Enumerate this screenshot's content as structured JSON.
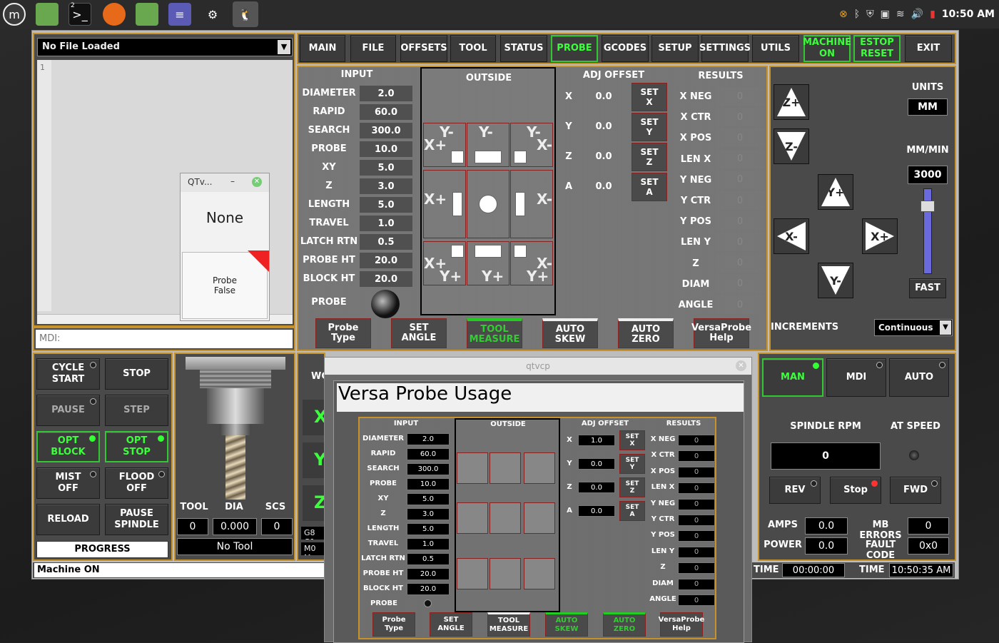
{
  "taskbar": {
    "clock": "10:50 AM",
    "term_badge": "2"
  },
  "file_combo": {
    "value": "No File Loaded"
  },
  "editor": {
    "line_no": "1"
  },
  "mdi": {
    "label": "MDI:"
  },
  "qt_popup": {
    "title": "QTv...",
    "minimize": "–",
    "value": "None",
    "probe_state": "Probe\nFalse"
  },
  "tabs": [
    "MAIN",
    "FILE",
    "OFFSETS",
    "TOOL",
    "STATUS",
    "PROBE",
    "GCODES",
    "SETUP",
    "SETTINGS",
    "UTILS"
  ],
  "machine_on": "MACHINE\nON",
  "estop": "ESTOP\nRESET",
  "exit": "EXIT",
  "probe_panel": {
    "input_title": "INPUT",
    "inputs": [
      {
        "label": "DIAMETER",
        "value": "2.0"
      },
      {
        "label": "RAPID",
        "value": "60.0"
      },
      {
        "label": "SEARCH",
        "value": "300.0"
      },
      {
        "label": "PROBE",
        "value": "10.0"
      },
      {
        "label": "XY",
        "value": "5.0"
      },
      {
        "label": "Z",
        "value": "3.0"
      },
      {
        "label": "LENGTH",
        "value": "5.0"
      },
      {
        "label": "TRAVEL",
        "value": "1.0"
      },
      {
        "label": "LATCH RTN",
        "value": "0.5"
      },
      {
        "label": "PROBE HT",
        "value": "20.0"
      },
      {
        "label": "BLOCK HT",
        "value": "20.0"
      }
    ],
    "probe_label": "PROBE",
    "outside_title": "OUTSIDE",
    "adj_title": "ADJ OFFSET",
    "adj": [
      {
        "axis": "X",
        "value": "0.0",
        "btn": "SET\nX"
      },
      {
        "axis": "Y",
        "value": "0.0",
        "btn": "SET\nY"
      },
      {
        "axis": "Z",
        "value": "0.0",
        "btn": "SET\nZ"
      },
      {
        "axis": "A",
        "value": "0.0",
        "btn": "SET\nA"
      }
    ],
    "results_title": "RESULTS",
    "results": [
      {
        "label": "X NEG",
        "value": "0"
      },
      {
        "label": "X CTR",
        "value": "0"
      },
      {
        "label": "X POS",
        "value": "0"
      },
      {
        "label": "LEN X",
        "value": "0"
      },
      {
        "label": "Y NEG",
        "value": "0"
      },
      {
        "label": "Y CTR",
        "value": "0"
      },
      {
        "label": "Y POS",
        "value": "0"
      },
      {
        "label": "LEN Y",
        "value": "0"
      },
      {
        "label": "Z",
        "value": "0"
      },
      {
        "label": "DIAM",
        "value": "0"
      },
      {
        "label": "ANGLE",
        "value": "0"
      }
    ],
    "bottom_buttons": [
      "Probe Type",
      "SET\nANGLE",
      "TOOL\nMEASURE",
      "AUTO\nSKEW",
      "AUTO\nZERO",
      "VersaProbe\nHelp"
    ]
  },
  "jog": {
    "units_label": "UNITS",
    "units": "MM",
    "rate_label": "MM/MIN",
    "rate": "3000",
    "fast": "FAST",
    "increments_label": "INCREMENTS",
    "increments": "Continuous",
    "zplus": "Z+",
    "zminus": "Z-",
    "yplus": "Y+",
    "yminus": "Y-",
    "xplus": "X+",
    "xminus": "X-"
  },
  "controls": {
    "cycle_start": "CYCLE\nSTART",
    "stop": "STOP",
    "pause": "PAUSE",
    "step": "STEP",
    "opt_block": "OPT\nBLOCK",
    "opt_stop": "OPT\nSTOP",
    "mist": "MIST\nOFF",
    "flood": "FLOOD\nOFF",
    "reload": "RELOAD",
    "pause_spindle": "PAUSE\nSPINDLE",
    "progress": "PROGRESS"
  },
  "tool": {
    "tool_label": "TOOL",
    "dia_label": "DIA",
    "scs_label": "SCS",
    "tool": "0",
    "dia": "0.000",
    "scs": "0",
    "name": "No Tool"
  },
  "mid": {
    "wc": "WC",
    "x": "X",
    "y": "Y",
    "z": "Z",
    "g8": "G8 G1",
    "m0": "M0 M"
  },
  "modes": {
    "man": "MAN",
    "mdi": "MDI",
    "auto": "AUTO"
  },
  "spindle": {
    "rpm_label": "SPINDLE RPM",
    "at_speed": "AT SPEED",
    "rpm": "0",
    "rev": "REV",
    "stop": "Stop",
    "fwd": "FWD",
    "amps_label": "AMPS",
    "amps": "0.0",
    "mb_errors_label": "MB ERRORS",
    "mb_errors": "0",
    "power_label": "POWER",
    "power": "0.0",
    "fault_label": "FAULT CODE",
    "fault": "0x0"
  },
  "status": {
    "text": "Machine ON",
    "time_label": "TIME",
    "time_run": "00:00:00",
    "time_label2": "TIME",
    "time_now": "10:50:35 AM"
  },
  "help_window": {
    "titlebar": "qtvcp",
    "heading": "Versa Probe Usage",
    "inputs": [
      "2.0",
      "60.0",
      "300.0",
      "10.0",
      "5.0",
      "3.0",
      "5.0",
      "1.0",
      "0.5",
      "20.0",
      "20.0"
    ],
    "adj": [
      "1.0",
      "0.0",
      "0.0",
      "0.0"
    ],
    "results": [
      "0",
      "0",
      "0",
      "0",
      "0",
      "0",
      "0",
      "0",
      "0",
      "0",
      "0"
    ],
    "bottom_buttons": [
      "Probe Type",
      "SET\nANGLE",
      "TOOL\nMEASURE",
      "AUTO\nSKEW",
      "AUTO\nZERO",
      "VersaProbe\nHelp"
    ]
  }
}
